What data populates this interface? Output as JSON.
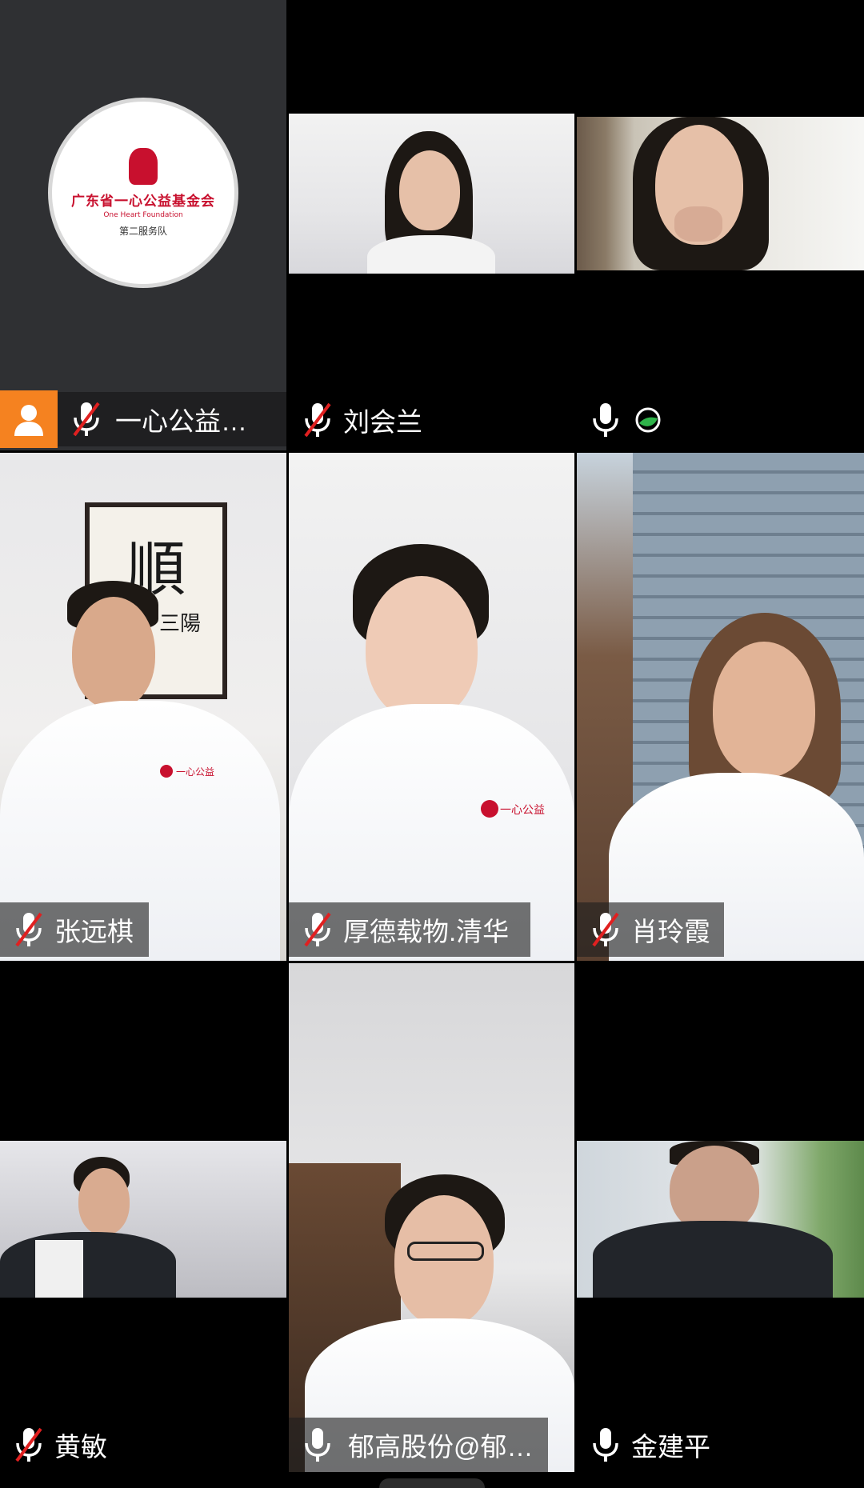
{
  "participants": [
    {
      "name": "一心公益…",
      "muted": true,
      "video": false
    },
    {
      "name": "刘会兰",
      "muted": true,
      "video": true
    },
    {
      "name": "",
      "muted": false,
      "video": true
    },
    {
      "name": "张远棋",
      "muted": true,
      "video": true
    },
    {
      "name": "厚德载物.清华",
      "muted": true,
      "video": true
    },
    {
      "name": "肖玲霞",
      "muted": true,
      "video": true
    },
    {
      "name": "黄敏",
      "muted": true,
      "video": true
    },
    {
      "name": "郁高股份@郁…",
      "muted": false,
      "video": true
    },
    {
      "name": "金建平",
      "muted": false,
      "video": true
    }
  ],
  "logo": {
    "title": "广东省一心公益基金会",
    "english": "One Heart Foundation",
    "subtitle": "第二服务队"
  },
  "scroll_art": {
    "character": "順",
    "small_text": "三陽"
  },
  "jacket_logo": "一心公益",
  "colors": {
    "accent": "#f58220",
    "mute_red": "#e02020",
    "brand_red": "#c8102e",
    "network_green": "#2fb34a"
  },
  "icons": {
    "mic": "microphone-icon",
    "muted": "microphone-muted-icon",
    "avatar": "user-avatar-icon",
    "network": "network-status-icon"
  }
}
